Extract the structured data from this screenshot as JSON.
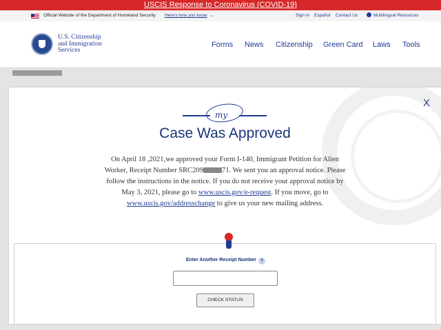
{
  "alert": {
    "text": "USCIS Response to Coronavirus (COVID-19)"
  },
  "utility": {
    "official": "Official Website of the Department of Homeland Security",
    "how_you_know": "Here's how you know",
    "sign_in": "Sign In",
    "espanol": "Español",
    "contact": "Contact Us",
    "multilingual": "Multilingual Resources"
  },
  "logo": {
    "line1": "U.S. Citizenship",
    "line2": "and Immigration",
    "line3": "Services"
  },
  "nav": {
    "forms": "Forms",
    "news": "News",
    "citizenship": "Citizenship",
    "green_card": "Green Card",
    "laws": "Laws",
    "tools": "Tools"
  },
  "modal": {
    "close": "X",
    "signature": "my",
    "title": "Case Was Approved",
    "text1a": "On April 18 ,2021,we approved your Form I-140, Immigrant Petition for Alien",
    "text2a": "Worker, Receipt Number SRC209",
    "text2b": "71. We sent you an approval notice. Please",
    "text3": "follow the instructions in the notice. If you do not receive your approval notice by",
    "text4a": "May 3, 2021, please go to ",
    "link1": "www.uscis.gov/e-request",
    "text4b": ". If you move, go to",
    "link2": "www.uscis.gov/addresschange",
    "text5": " to give us your new mailing address."
  },
  "receipt": {
    "label": "Enter Another Receipt Number",
    "help": "?",
    "value": "",
    "button": "CHECK STATUS"
  },
  "colors": {
    "brand_blue": "#1f3a93",
    "alert_red": "#d62828"
  }
}
